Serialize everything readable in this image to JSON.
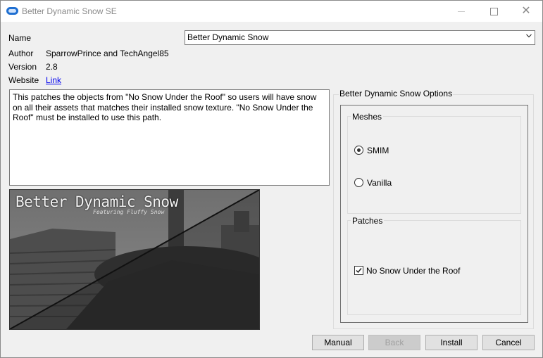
{
  "window": {
    "title": "Better Dynamic Snow SE"
  },
  "icons": {
    "app": "app-icon",
    "minimize": "minimize-icon",
    "maximize": "maximize-icon",
    "close": "close-icon",
    "dropdown": "chevron-down-icon",
    "check": "checkmark-icon"
  },
  "info": {
    "name_label": "Name",
    "name_value": "Better Dynamic Snow",
    "author_label": "Author",
    "author_value": "SparrowPrince and TechAngel85",
    "version_label": "Version",
    "version_value": "2.8",
    "website_label": "Website",
    "website_link": "Link"
  },
  "description": "This patches the objects from \"No Snow Under the Roof\" so users will have snow on all their assets that matches their installed snow texture. \"No Snow Under the Roof\" must be installed to use this path.",
  "preview": {
    "title": "Better Dynamic Snow",
    "subtitle": "Featuring Fluffy Snow"
  },
  "options": {
    "title": "Better Dynamic Snow Options",
    "meshes": {
      "title": "Meshes",
      "items": [
        {
          "label": "SMIM",
          "checked": true
        },
        {
          "label": "Vanilla",
          "checked": false
        }
      ]
    },
    "patches": {
      "title": "Patches",
      "items": [
        {
          "label": "No Snow Under the Roof",
          "checked": true
        }
      ]
    }
  },
  "buttons": {
    "manual": "Manual",
    "back": "Back",
    "install": "Install",
    "cancel": "Cancel"
  }
}
